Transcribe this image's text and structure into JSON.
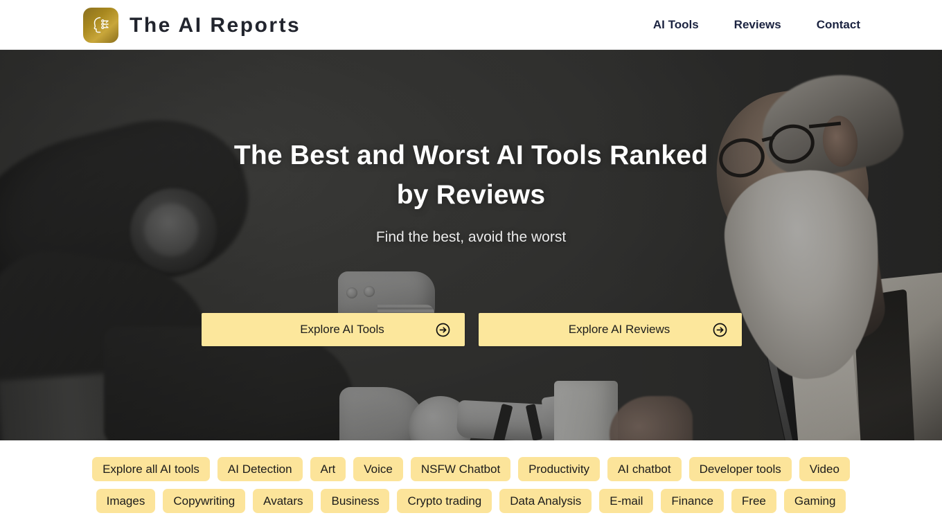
{
  "header": {
    "logo_icon": "ai-head-profile-icon",
    "brand_name": "The AI Reports",
    "nav": [
      {
        "label": "AI Tools"
      },
      {
        "label": "Reviews"
      },
      {
        "label": "Contact"
      }
    ]
  },
  "hero": {
    "title": "The Best and Worst AI Tools Ranked by Reviews",
    "subtitle": "Find the best, avoid the worst",
    "ctas": [
      {
        "label": "Explore AI Tools",
        "icon": "arrow-right-circle-icon"
      },
      {
        "label": "Explore AI Reviews",
        "icon": "arrow-right-circle-icon"
      }
    ],
    "background_description": "Dark studio photo: blurred black robot arm at left, white robotic arm with gripper handing a white cup to a person at center, elderly bearded man with glasses in a light suit holding a laptop at right"
  },
  "tags": {
    "row1": [
      {
        "label": "Explore all AI tools"
      },
      {
        "label": "AI Detection"
      },
      {
        "label": "Art"
      },
      {
        "label": "Voice"
      },
      {
        "label": "NSFW Chatbot"
      },
      {
        "label": "Productivity"
      },
      {
        "label": "AI chatbot"
      },
      {
        "label": "Developer tools"
      },
      {
        "label": "Video"
      }
    ],
    "row2": [
      {
        "label": "Images"
      },
      {
        "label": "Copywriting"
      },
      {
        "label": "Avatars"
      },
      {
        "label": "Business"
      },
      {
        "label": "Crypto trading"
      },
      {
        "label": "Data Analysis"
      },
      {
        "label": "E-mail"
      },
      {
        "label": "Finance"
      },
      {
        "label": "Free"
      },
      {
        "label": "Gaming"
      }
    ]
  },
  "colors": {
    "accent_yellow": "#fce49a",
    "cta_yellow": "#fce79c",
    "logo_gold": "#a8881f",
    "nav_text": "#1b2340",
    "page_background": "#ffffff",
    "hero_overlay": "#2d2d2b"
  }
}
